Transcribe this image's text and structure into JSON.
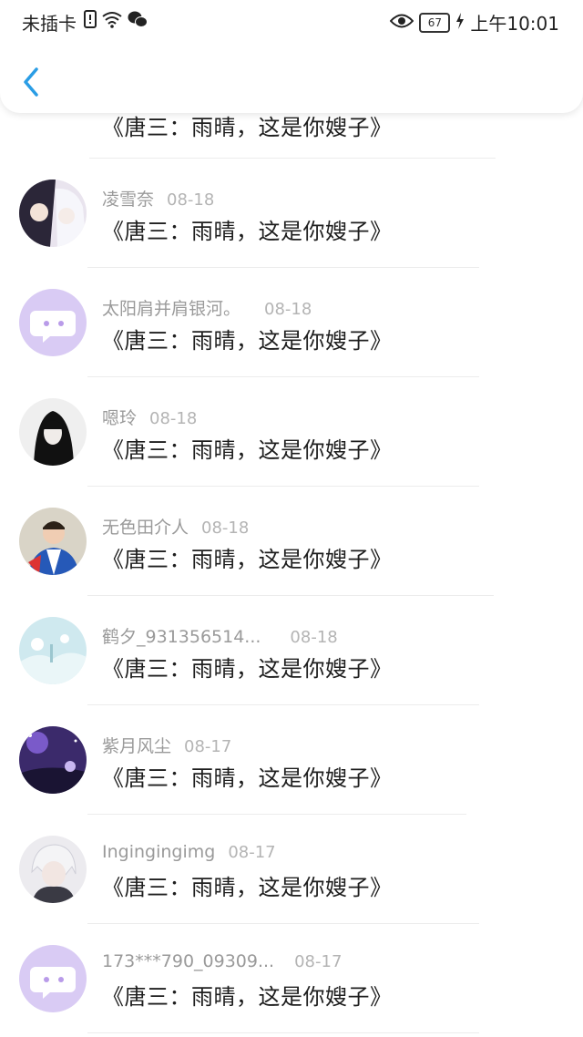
{
  "status_bar": {
    "carrier": "未插卡",
    "battery": "67",
    "time": "上午10:01",
    "icons": [
      "sim-alert-icon",
      "wifi-icon",
      "wechat-icon",
      "eye-icon",
      "battery-icon",
      "charging-icon"
    ]
  },
  "header": {
    "back_icon": "chevron-left-icon",
    "accent": "#2a9de5"
  },
  "items": [
    {
      "name": "",
      "date": "",
      "title": "《唐三：雨晴，这是你嫂子》",
      "avatar": "photo-dark"
    },
    {
      "name": "凌雪奈",
      "date": "08-18",
      "title": "《唐三：雨晴，这是你嫂子》",
      "avatar": "anime-couple"
    },
    {
      "name": "太阳肩并肩银河。",
      "date": "08-18",
      "title": "《唐三：雨晴，这是你嫂子》",
      "avatar": "default-chat"
    },
    {
      "name": "嗯玲",
      "date": "08-18",
      "title": "《唐三：雨晴，这是你嫂子》",
      "avatar": "anime-dark"
    },
    {
      "name": "无色田介人",
      "date": "08-18",
      "title": "《唐三：雨晴，这是你嫂子》",
      "avatar": "boy-jacket"
    },
    {
      "name": "鹤夕_931356514...",
      "date": "08-18",
      "title": "《唐三：雨晴，这是你嫂子》",
      "avatar": "snow-scene"
    },
    {
      "name": "紫月风尘",
      "date": "08-17",
      "title": "《唐三：雨晴，这是你嫂子》",
      "avatar": "purple-night"
    },
    {
      "name": "Ingingingimg",
      "date": "08-17",
      "title": "《唐三：雨晴，这是你嫂子》",
      "avatar": "anime-white-hair"
    },
    {
      "name": "173***790_09309...",
      "date": "08-17",
      "title": "《唐三：雨晴，这是你嫂子》",
      "avatar": "default-chat"
    }
  ]
}
